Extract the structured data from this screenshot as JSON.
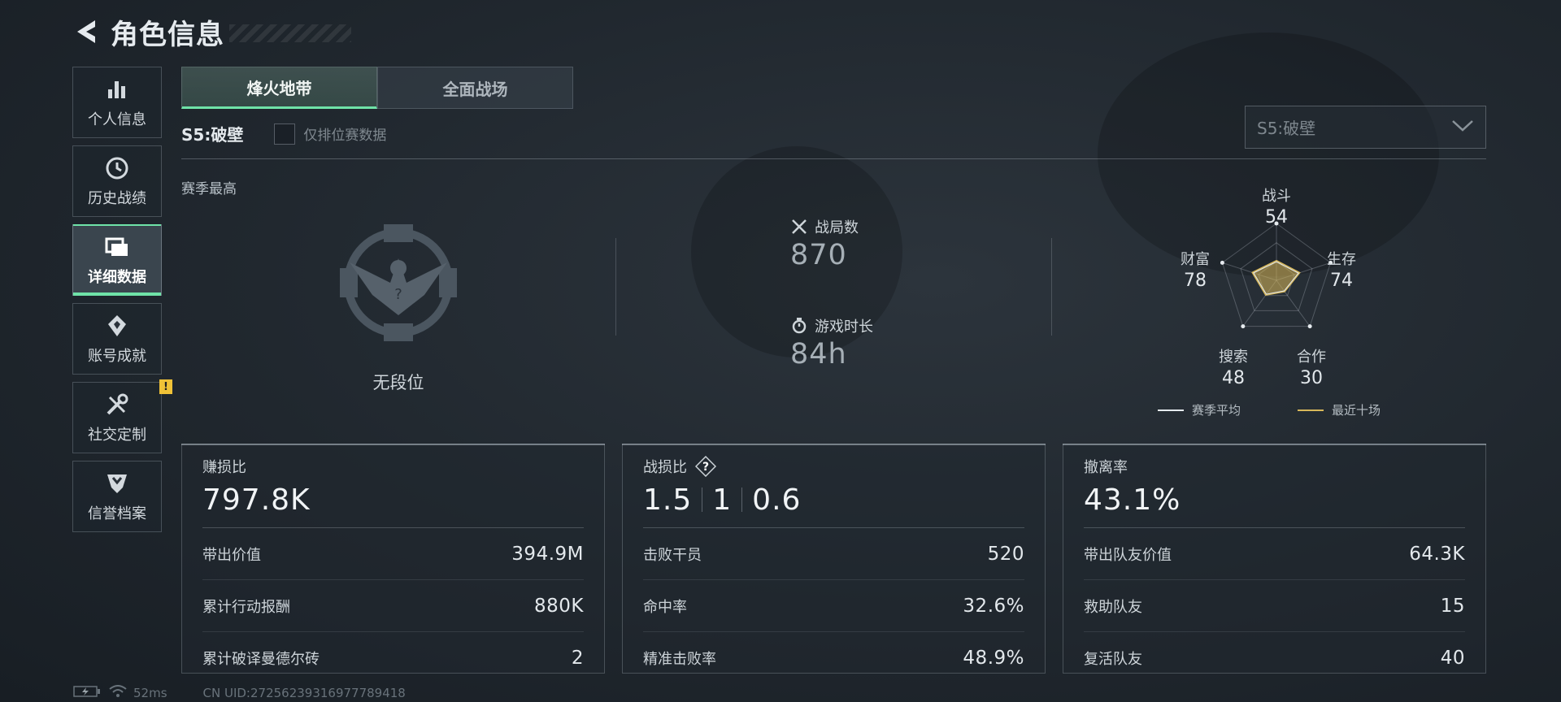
{
  "header": {
    "title": "角色信息"
  },
  "sidebar": {
    "items": [
      {
        "label": "个人信息"
      },
      {
        "label": "历史战绩"
      },
      {
        "label": "详细数据"
      },
      {
        "label": "账号成就"
      },
      {
        "label": "社交定制",
        "badge": "!"
      },
      {
        "label": "信誉档案"
      }
    ]
  },
  "tabs": [
    {
      "label": "烽火地带"
    },
    {
      "label": "全面战场"
    }
  ],
  "season": {
    "label": "S5:破壁",
    "checkbox_label": "仅排位赛数据",
    "select_value": "S5:破壁"
  },
  "overview": {
    "section_title": "赛季最高",
    "rank_label": "无段位",
    "matches_label": "战局数",
    "matches_value": "870",
    "playtime_label": "游戏时长",
    "playtime_value": "84h"
  },
  "radar": {
    "axes": [
      {
        "label": "战斗",
        "value": "54"
      },
      {
        "label": "生存",
        "value": "74"
      },
      {
        "label": "合作",
        "value": "30"
      },
      {
        "label": "搜索",
        "value": "48"
      },
      {
        "label": "财富",
        "value": "78"
      }
    ],
    "legend_avg": "赛季平均",
    "legend_recent": "最近十场",
    "colors": {
      "avg": "#e6ebef",
      "recent": "#d8b85a"
    }
  },
  "cards": [
    {
      "title": "赚损比",
      "big": "797.8K",
      "rows": [
        {
          "label": "带出价值",
          "value": "394.9M"
        },
        {
          "label": "累计行动报酬",
          "value": "880K"
        },
        {
          "label": "累计破译曼德尔砖",
          "value": "2"
        }
      ]
    },
    {
      "title": "战损比",
      "big_parts": [
        "1.5",
        "1",
        "0.6"
      ],
      "rows": [
        {
          "label": "击败干员",
          "value": "520"
        },
        {
          "label": "命中率",
          "value": "32.6%"
        },
        {
          "label": "精准击败率",
          "value": "48.9%"
        }
      ]
    },
    {
      "title": "撤离率",
      "big": "43.1%",
      "rows": [
        {
          "label": "带出队友价值",
          "value": "64.3K"
        },
        {
          "label": "救助队友",
          "value": "15"
        },
        {
          "label": "复活队友",
          "value": "40"
        }
      ]
    }
  ],
  "footer": {
    "ping": "52ms",
    "uid": "CN UID:27256239316977789418"
  }
}
